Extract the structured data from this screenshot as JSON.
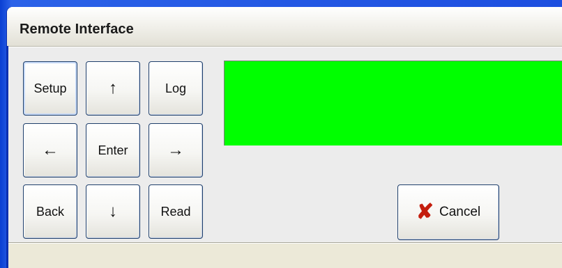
{
  "window": {
    "title": "Remote Interface"
  },
  "keypad": {
    "setup": "Setup",
    "up": "↑",
    "log": "Log",
    "left": "←",
    "enter": "Enter",
    "right": "→",
    "back": "Back",
    "down": "↓",
    "read": "Read"
  },
  "display": {
    "color": "#00ff00",
    "text": ""
  },
  "actions": {
    "cancel_icon": "✘",
    "cancel_label": "Cancel"
  },
  "icons": {
    "cancel_icon_name": "x-icon"
  },
  "colors": {
    "desktop": "#1d4fe0",
    "window_bg": "#ece9d8",
    "button_border": "#1f3f6b",
    "cancel_x": "#c41e0e"
  }
}
